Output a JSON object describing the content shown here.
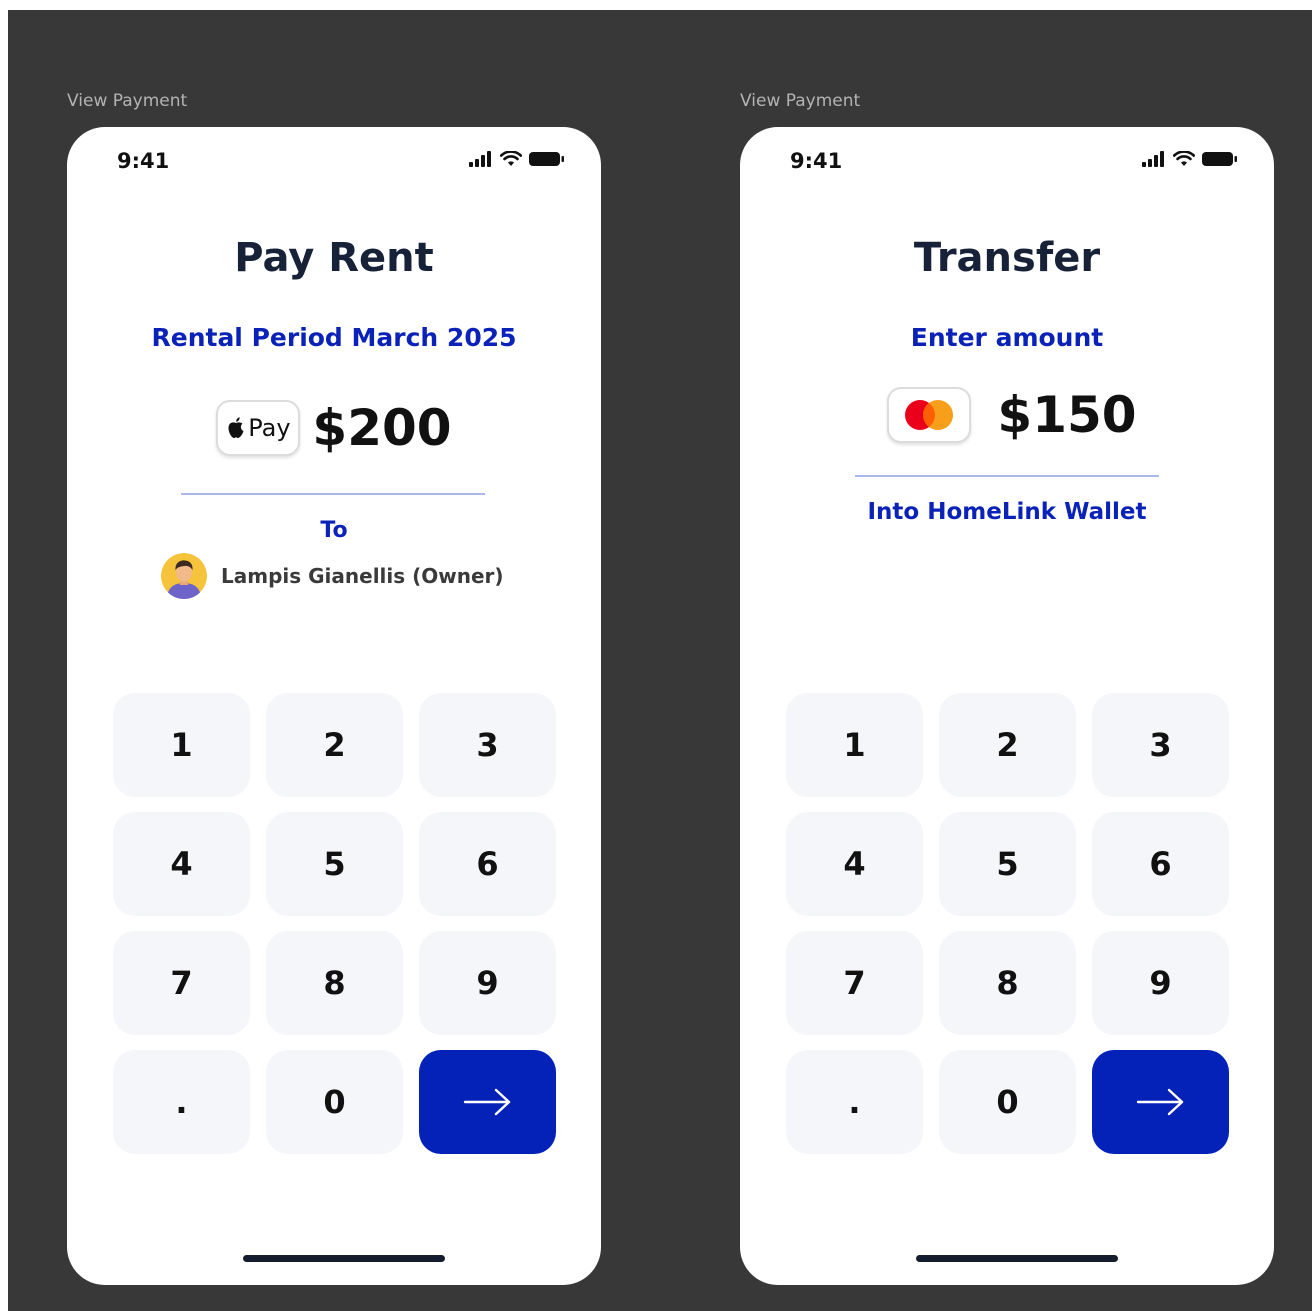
{
  "screens": [
    {
      "frame_label": "View Payment",
      "status": {
        "time": "9:41"
      },
      "title": "Pay Rent",
      "subtitle": "Rental Period March 2025",
      "payment_method": {
        "badge_text": "Pay",
        "icon": "apple-icon"
      },
      "amount": "$200",
      "to_label": "To",
      "recipient": {
        "name": "Lampis Gianellis (Owner)"
      },
      "keypad": [
        "1",
        "2",
        "3",
        "4",
        "5",
        "6",
        "7",
        "8",
        "9",
        ".",
        "0"
      ]
    },
    {
      "frame_label": "View Payment",
      "status": {
        "time": "9:41"
      },
      "title": "Transfer",
      "subtitle": "Enter amount",
      "payment_method": {
        "icon": "mastercard-icon"
      },
      "amount": "$150",
      "destination": "Into HomeLink Wallet",
      "keypad": [
        "1",
        "2",
        "3",
        "4",
        "5",
        "6",
        "7",
        "8",
        "9",
        ".",
        "0"
      ]
    }
  ],
  "colors": {
    "background": "#383838",
    "primary_blue": "#0422b8",
    "title_navy": "#172238",
    "key_bg": "#f5f6f9"
  }
}
